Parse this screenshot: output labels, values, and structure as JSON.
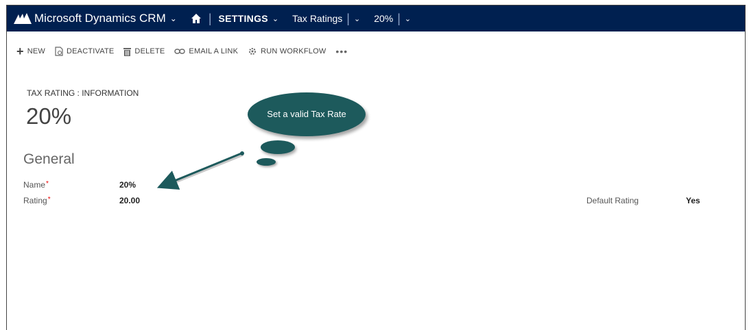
{
  "nav": {
    "brand": "Microsoft Dynamics CRM",
    "area": "SETTINGS",
    "entity": "Tax Ratings",
    "record": "20%"
  },
  "commands": [
    {
      "label": "NEW",
      "icon": "plus-icon"
    },
    {
      "label": "DEACTIVATE",
      "icon": "deactivate-icon"
    },
    {
      "label": "DELETE",
      "icon": "trash-icon"
    },
    {
      "label": "EMAIL A LINK",
      "icon": "link-icon"
    },
    {
      "label": "RUN WORKFLOW",
      "icon": "workflow-icon"
    },
    {
      "label": "•••",
      "icon": "more-icon"
    }
  ],
  "form": {
    "entity_type": "TAX RATING : INFORMATION",
    "title": "20%",
    "section": "General",
    "fields": {
      "name_label": "Name",
      "name_value": "20%",
      "rating_label": "Rating",
      "rating_value": "20.00",
      "default_label": "Default Rating",
      "default_value": "Yes",
      "required_mark": "*"
    }
  },
  "callout": {
    "text": "Set a valid Tax Rate",
    "color": "#1d5a5c"
  },
  "colors": {
    "navbar": "#002050",
    "required": "#e00000"
  }
}
